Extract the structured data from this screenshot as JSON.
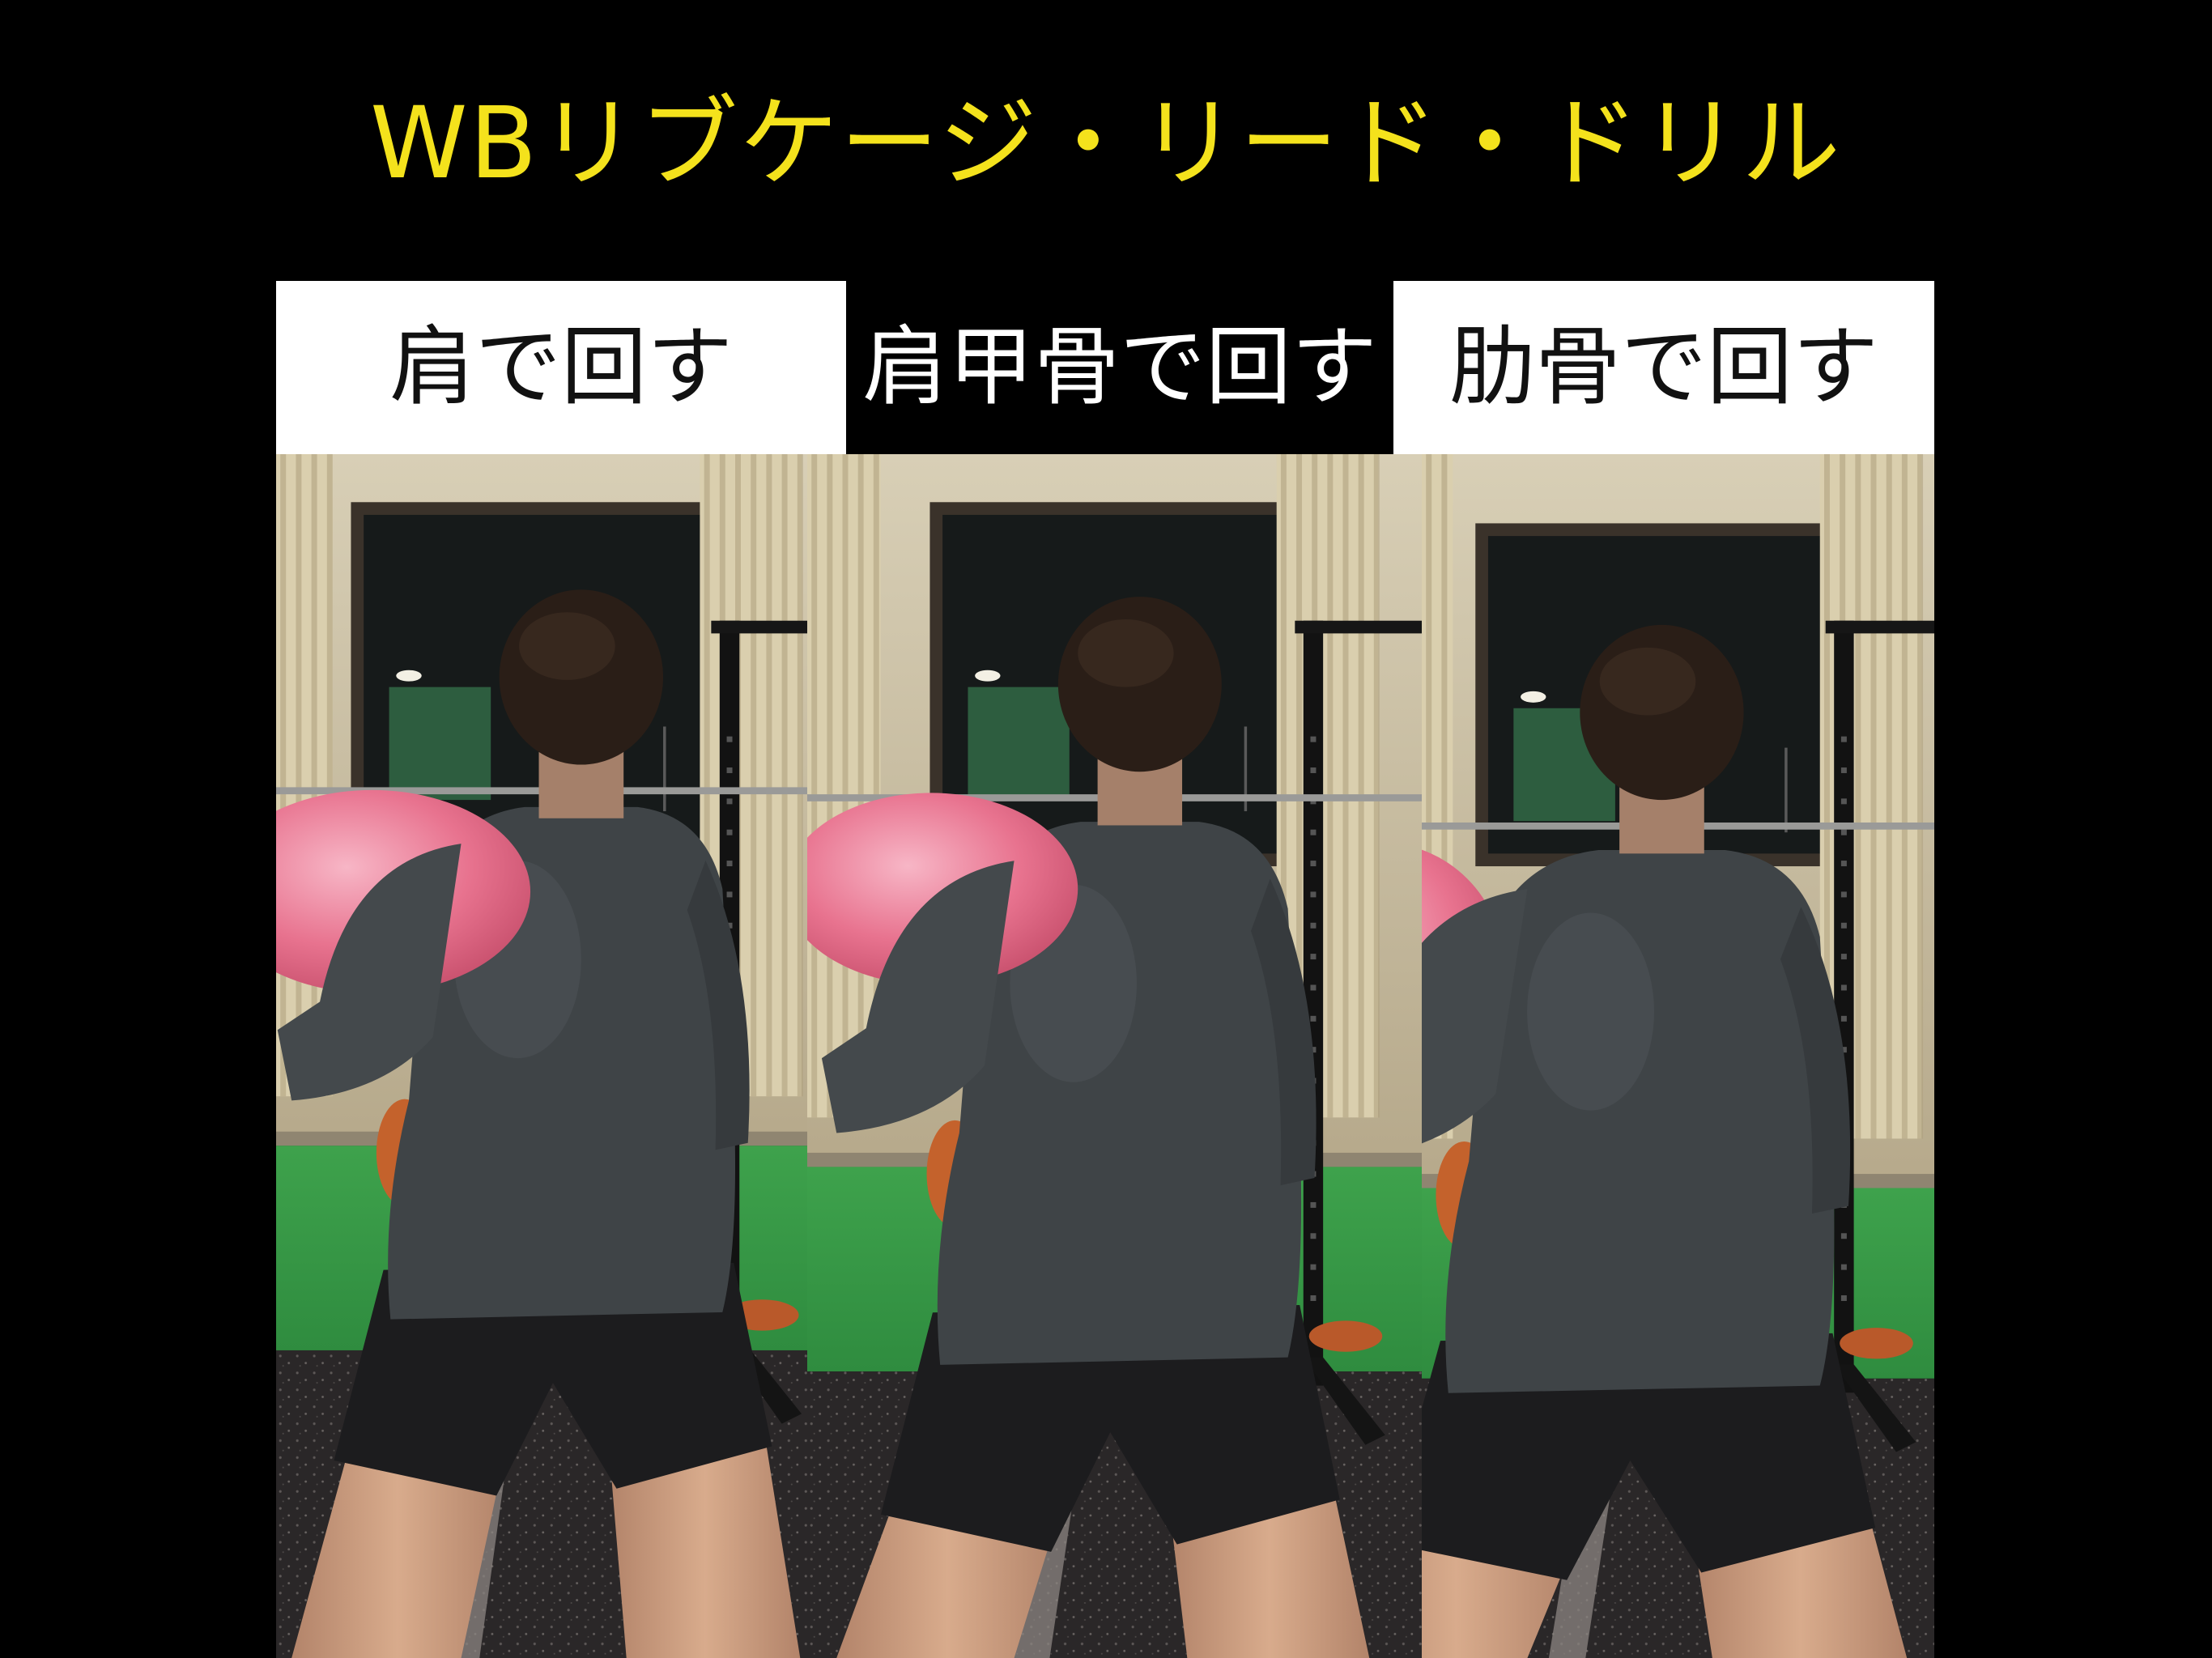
{
  "title": "WBリブケージ・リード・ドリル",
  "panels": [
    {
      "label": "肩で回す"
    },
    {
      "label": "肩甲骨で回す"
    },
    {
      "label": "肋骨で回す"
    }
  ],
  "colors": {
    "background": "#000000",
    "title": "#f4e21c",
    "label_light_bg": "#ffffff",
    "label_light_text": "#111111",
    "label_dark_bg": "#000000",
    "label_dark_text": "#ffffff",
    "exercise_bag": "#e8738f",
    "shirt": "#3f4447",
    "turf": "#2f8c3f"
  }
}
